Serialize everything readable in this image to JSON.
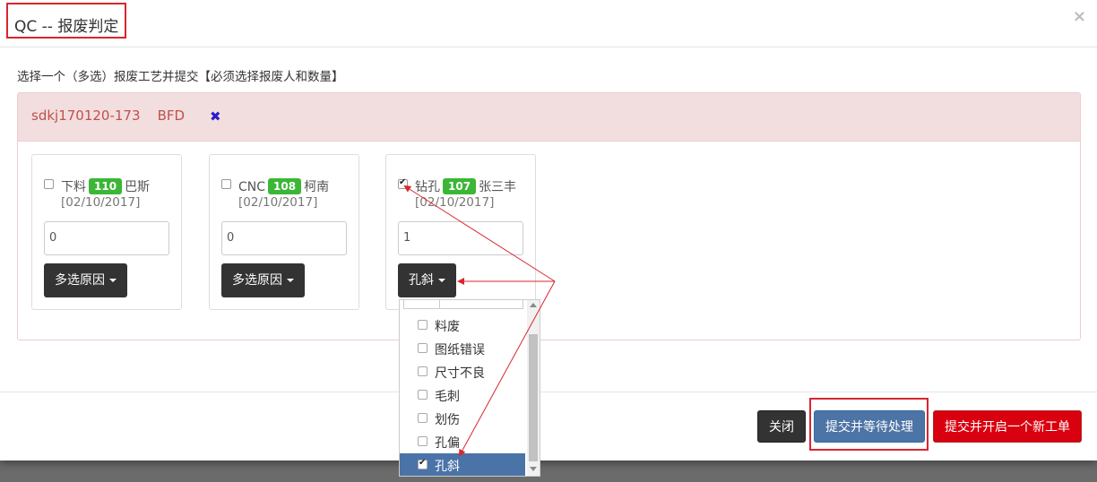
{
  "header": {
    "title": "QC -- 报废判定",
    "close": "×"
  },
  "instruction": "选择一个（多选）报废工艺并提交【必须选择报废人和数量】",
  "panel": {
    "heading": "sdkj170120-173    BFD",
    "remove_icon": "✖"
  },
  "cards": [
    {
      "label_pre": "下料",
      "badge": "110",
      "label_post": "巴斯",
      "date": "[02/10/2017]",
      "qty": "0",
      "button": "多选原因",
      "checked": false
    },
    {
      "label_pre": "CNC",
      "badge": "108",
      "label_post": "柯南",
      "date": "[02/10/2017]",
      "qty": "0",
      "button": "多选原因",
      "checked": false
    },
    {
      "label_pre": "钻孔",
      "badge": "107",
      "label_post": "张三丰",
      "date": "[02/10/2017]",
      "qty": "1",
      "button": "孔斜",
      "checked": true
    }
  ],
  "dropdown": {
    "items": [
      {
        "label": "料废",
        "checked": false
      },
      {
        "label": "图纸错误",
        "checked": false
      },
      {
        "label": "尺寸不良",
        "checked": false
      },
      {
        "label": "毛刺",
        "checked": false
      },
      {
        "label": "划伤",
        "checked": false
      },
      {
        "label": "孔偏",
        "checked": false
      },
      {
        "label": "孔斜",
        "checked": true
      }
    ]
  },
  "footer": {
    "close": "关闭",
    "submit_wait": "提交并等待处理",
    "submit_new": "提交并开启一个新工单"
  },
  "colors": {
    "badge": "#3cb636",
    "highlight": "#d8262f",
    "active_item": "#4a73a8",
    "danger": "#d9000f",
    "primary": "#4d74a6"
  }
}
